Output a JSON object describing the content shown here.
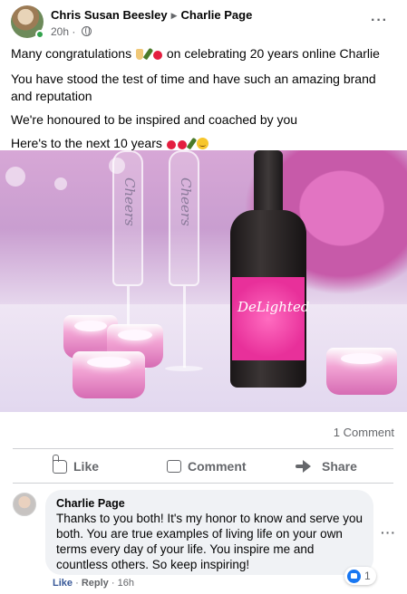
{
  "post": {
    "author": "Chris Susan Beesley",
    "target": "Charlie Page",
    "timestamp": "20h",
    "audience_icon": "globe-icon",
    "lines": {
      "line1_before": "Many congratulations",
      "line1_after": "on celebrating 20 years online Charlie",
      "line2": "You have stood the test of time and have such an amazing brand and reputation",
      "line3": "We're honoured to be inspired and coached by you",
      "line4": "Here's to the next 10 years"
    },
    "photo": {
      "glass_text_1": "Cheers",
      "glass_text_2": "Cheers",
      "bottle_label": "DeLighted"
    },
    "comment_count": "1 Comment",
    "actions": {
      "like": "Like",
      "comment": "Comment",
      "share": "Share"
    }
  },
  "comment": {
    "author": "Charlie Page",
    "text": "Thanks to you both! It's my honor to know and serve you both. You are true examples of living life on your own terms every day of your life. You inspire me and countless others. So keep inspiring!",
    "reaction_count": "1",
    "like_label": "Like",
    "reply_label": "Reply",
    "separator": "·",
    "time": "16h"
  },
  "colors": {
    "accent": "#1877f2",
    "secondary_text": "#65676b",
    "bubble": "#f0f2f5",
    "online": "#31a24c"
  }
}
